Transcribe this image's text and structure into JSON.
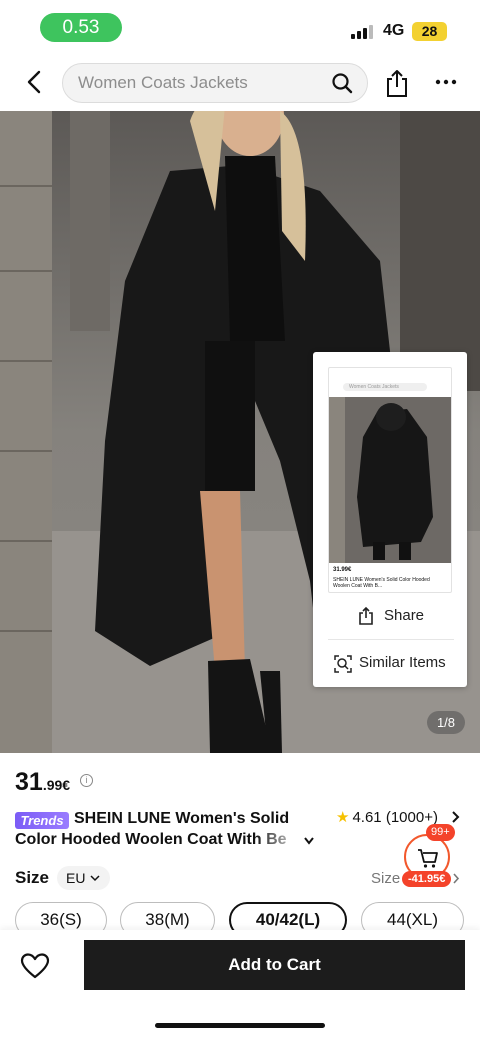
{
  "status_bar": {
    "time": "0.53",
    "network": "4G",
    "battery": "28"
  },
  "header": {
    "search_placeholder": "Women Coats Jackets"
  },
  "gallery": {
    "indicator": "1/8"
  },
  "share_card": {
    "share_label": "Share",
    "similar_label": "Similar Items",
    "thumb_search": "Women Coats Jackets",
    "thumb_price": "31.99€",
    "thumb_title": "SHEIN LUNE Women's Solid Color Hooded Woolen Coat With B..."
  },
  "product": {
    "price_whole": "31",
    "price_cents": ".99€",
    "badge": "Trends",
    "title_line1": "SHEIN LUNE Women's Solid",
    "title_line2": "Color Hooded Woolen Coat With Be",
    "rating": "4.61",
    "review_count": "(1000+)"
  },
  "cart": {
    "count": "99+",
    "discount": "-41.95€"
  },
  "size": {
    "label": "Size",
    "region": "EU",
    "guide_label": "Size",
    "options": [
      {
        "label": "36(S)",
        "selected": false
      },
      {
        "label": "38(M)",
        "selected": false
      },
      {
        "label": "40/42(L)",
        "selected": true
      },
      {
        "label": "44(XL)",
        "selected": false
      }
    ]
  },
  "bottom_bar": {
    "add_to_cart_label": "Add to Cart"
  },
  "colors": {
    "accent": "#f4432a",
    "status_green": "#3ec45e",
    "badge_purple": "#7b5cf6",
    "primary_button": "#1c1c1c"
  }
}
